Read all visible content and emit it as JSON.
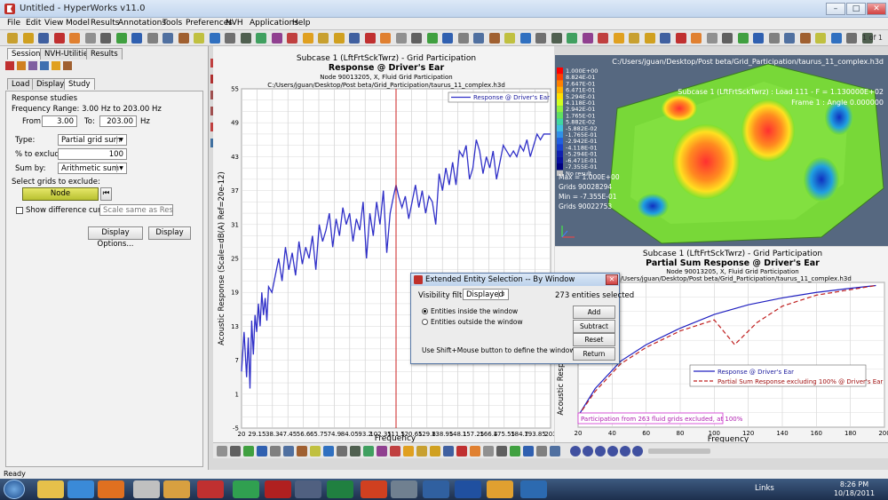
{
  "window": {
    "title": "Untitled - HyperWorks v11.0"
  },
  "menu": [
    "File",
    "Edit",
    "View",
    "Model",
    "Results",
    "Annotations",
    "Tools",
    "Preferences",
    "NVH",
    "Applications",
    "Help"
  ],
  "page_indicator": "1 of 1",
  "left_panel": {
    "top_tabs": [
      "Session",
      "NVH-Utilities",
      "Results"
    ],
    "sub_tabs": [
      "Load",
      "Display",
      "Study"
    ],
    "section_title": "Response studies",
    "freq_range": "Frequency Range: 3.00 Hz to 203.00 Hz",
    "from_label": "From:",
    "from_value": "3.00",
    "to_label": "To:",
    "to_value": "203.00",
    "hz_label": "Hz",
    "type_label": "Type:",
    "type_value": "Partial grid sum",
    "exclude_label": "% to exclude:",
    "exclude_value": "100",
    "sumby_label": "Sum by:",
    "sumby_value": "Arithmetic sum",
    "select_label": "Select grids to exclude:",
    "node_button": "Node",
    "show_diff_label": "Show difference curve as:",
    "show_diff_value": "Scale same as Respon",
    "display_options_button": "Display Options...",
    "display_button": "Display"
  },
  "plot1": {
    "subtitle": "Subcase 1 (LftFrtSckTwrz) - Grid Participation",
    "title": "Response @ Driver's Ear",
    "node_line": "Node 90013205, X, Fluid Grid Participation",
    "path_line": "C:/Users/jguan/Desktop/Post beta/Grid_Participation/taurus_11_complex.h3d",
    "legend": "Response @ Driver's Ear"
  },
  "chart_data": [
    {
      "type": "line",
      "title": "Response @ Driver's Ear",
      "xlabel": "Frequency",
      "ylabel": "Acoustic Response (Scale=dB(A) Ref=20e-12)",
      "xlim": [
        20,
        203
      ],
      "ylim": [
        -5,
        55
      ],
      "x_ticks": [
        "20",
        "29.15",
        "38.3",
        "47.45",
        "56.6",
        "65.75",
        "74.9",
        "84.05",
        "93.2",
        "102.35",
        "111.5",
        "120.65",
        "129.8",
        "138.95",
        "148.1",
        "157.25",
        "166.4",
        "175.55",
        "184.7",
        "193.85",
        "203"
      ],
      "y_ticks": [
        "-5",
        "1",
        "7",
        "13",
        "19",
        "25",
        "31",
        "37",
        "43",
        "49",
        "55"
      ],
      "marker_x": 111.5,
      "series": [
        {
          "name": "Response @ Driver's Ear",
          "color": "#3030c8",
          "x": [
            20,
            21.5,
            23,
            24,
            25,
            26,
            27,
            28,
            29,
            30,
            31,
            32,
            33,
            34,
            35,
            36,
            38,
            40,
            42,
            44,
            46,
            48,
            50,
            52,
            54,
            56,
            58,
            60,
            62,
            64,
            66,
            68,
            70,
            72,
            74,
            76,
            78,
            80,
            82,
            84,
            86,
            88,
            90,
            92,
            94,
            96,
            98,
            100,
            102,
            104,
            106,
            108,
            110,
            111.5,
            113,
            115,
            117,
            119,
            121,
            123,
            125,
            127,
            129,
            131,
            133,
            135,
            137,
            139,
            141,
            143,
            145,
            147,
            149,
            151,
            153,
            155,
            157,
            159,
            161,
            163,
            165,
            167,
            169,
            171,
            173,
            175,
            177,
            179,
            181,
            183,
            185,
            187,
            189,
            191,
            193,
            195,
            197,
            199,
            201,
            203
          ],
          "y": [
            5,
            12,
            4,
            11,
            2,
            14,
            8,
            15,
            12,
            17,
            13,
            19,
            15,
            18,
            14,
            20,
            19,
            22,
            25,
            21,
            27,
            23,
            26,
            22,
            28,
            24,
            27,
            25,
            29,
            23,
            31,
            28,
            30,
            33,
            27,
            32,
            29,
            34,
            31,
            33,
            28,
            32,
            30,
            35,
            25,
            33,
            29,
            35,
            31,
            37,
            26,
            33,
            36,
            38,
            36,
            34,
            36,
            32,
            35,
            38,
            34,
            37,
            33,
            36,
            35,
            31,
            40,
            37,
            41,
            38,
            42,
            38,
            44,
            43,
            45,
            39,
            41,
            46,
            44,
            40,
            43,
            41,
            44,
            39,
            42,
            45,
            44,
            43,
            44,
            43,
            45,
            44,
            46,
            43,
            45,
            47,
            46,
            47,
            47,
            47
          ]
        }
      ]
    },
    {
      "type": "line",
      "title": "Partial Sum Response @ Driver's Ear",
      "xlabel": "Frequency",
      "ylabel": "Acoustic Response",
      "xlim": [
        20,
        200
      ],
      "ylim": [
        0,
        100
      ],
      "x_ticks": [
        "20",
        "40",
        "60",
        "80",
        "100",
        "120",
        "140",
        "160",
        "180",
        "200"
      ],
      "annotation": "Participation from 263 fluid grids excluded, at 100%",
      "series": [
        {
          "name": "Response @ Driver's Ear",
          "color": "#2020c0",
          "dash": false,
          "x": [
            20,
            30,
            45,
            60,
            80,
            100,
            120,
            140,
            160,
            180,
            195
          ],
          "y": [
            8,
            28,
            48,
            60,
            72,
            82,
            89,
            94,
            98,
            101,
            103
          ]
        },
        {
          "name": "Partial Sum Response excluding 100% @ Driver's Ear",
          "color": "#c02020",
          "dash": true,
          "x": [
            20,
            30,
            45,
            60,
            80,
            100,
            112,
            125,
            140,
            160,
            180,
            195
          ],
          "y": [
            8,
            26,
            46,
            58,
            70,
            78,
            60,
            76,
            88,
            96,
            100,
            103
          ]
        }
      ]
    }
  ],
  "plot2": {
    "subtitle": "Subcase 1 (LftFrtSckTwrz) - Grid Participation",
    "title": "Partial Sum Response @ Driver's Ear",
    "node_line": "Node 90013205, X, Fluid Grid Participation",
    "path_line": "C:/Users/jguan/Desktop/Post beta/Grid_Participation/taurus_11_complex.h3d"
  },
  "gfx": {
    "path": "C:/Users/jguan/Desktop/Post beta/Grid_Participation/taurus_11_complex.h3d",
    "subcase": "Subcase 1 (LftFrtSckTwrz) : Load 111 - F = 1.130000E+02",
    "frame": "Frame 1 : Angle 0.000000",
    "legend_values": [
      "1.000E+00",
      "8.824E-01",
      "7.647E-01",
      "6.471E-01",
      "5.294E-01",
      "4.118E-01",
      "2.942E-01",
      "1.765E-01",
      "5.882E-02",
      "-5.882E-02",
      "-1.765E-01",
      "-2.942E-01",
      "-4.118E-01",
      "-5.294E-01",
      "-6.471E-01",
      "-7.355E-01"
    ],
    "no_result": "No result",
    "max_line": "Max = 1.000E+00",
    "max_grid": "Grids 90028294",
    "min_line": "Min = -7.355E-01",
    "min_grid": "Grids 90022753"
  },
  "dialog": {
    "title": "Extended Entity Selection -- By Window",
    "visibility_label": "Visibility filter:",
    "visibility_value": "Displayed",
    "selected_count": "273 entities selected",
    "opt_inside": "Entities inside the window",
    "opt_outside": "Entities outside the window",
    "hint": "Use Shift+Mouse button to define the window",
    "buttons": [
      "Add",
      "Subtract",
      "Reset",
      "Return"
    ]
  },
  "status": {
    "text": "Ready"
  },
  "taskbar": {
    "links": "Links",
    "time": "8:26 PM",
    "date": "10/18/2011"
  }
}
